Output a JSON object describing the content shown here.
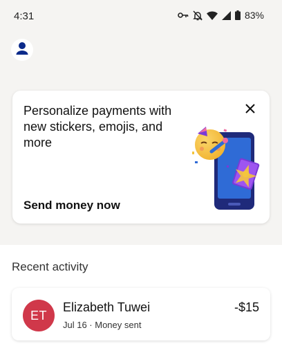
{
  "status_bar": {
    "time": "4:31",
    "battery": "83%",
    "icons": [
      "key-icon",
      "bell-off-icon",
      "wifi-icon",
      "cell-signal-icon",
      "battery-icon"
    ]
  },
  "header": {
    "profile_icon": "person-icon"
  },
  "promo": {
    "title": "Personalize payments with new stickers, emojis, and more",
    "cta": "Send money now",
    "close_icon": "close-icon",
    "illustration": "party-face-phone-illustration"
  },
  "recent_activity": {
    "title": "Recent activity",
    "items": [
      {
        "initials": "ET",
        "name": "Elizabeth Tuwei",
        "meta": "Jul 16 · Money sent",
        "amount": "-$15",
        "avatar_color": "#d0384a"
      }
    ]
  },
  "colors": {
    "background_top": "#f5f4f2",
    "brand_navy": "#0b2a8a",
    "avatar_red": "#d0384a"
  }
}
